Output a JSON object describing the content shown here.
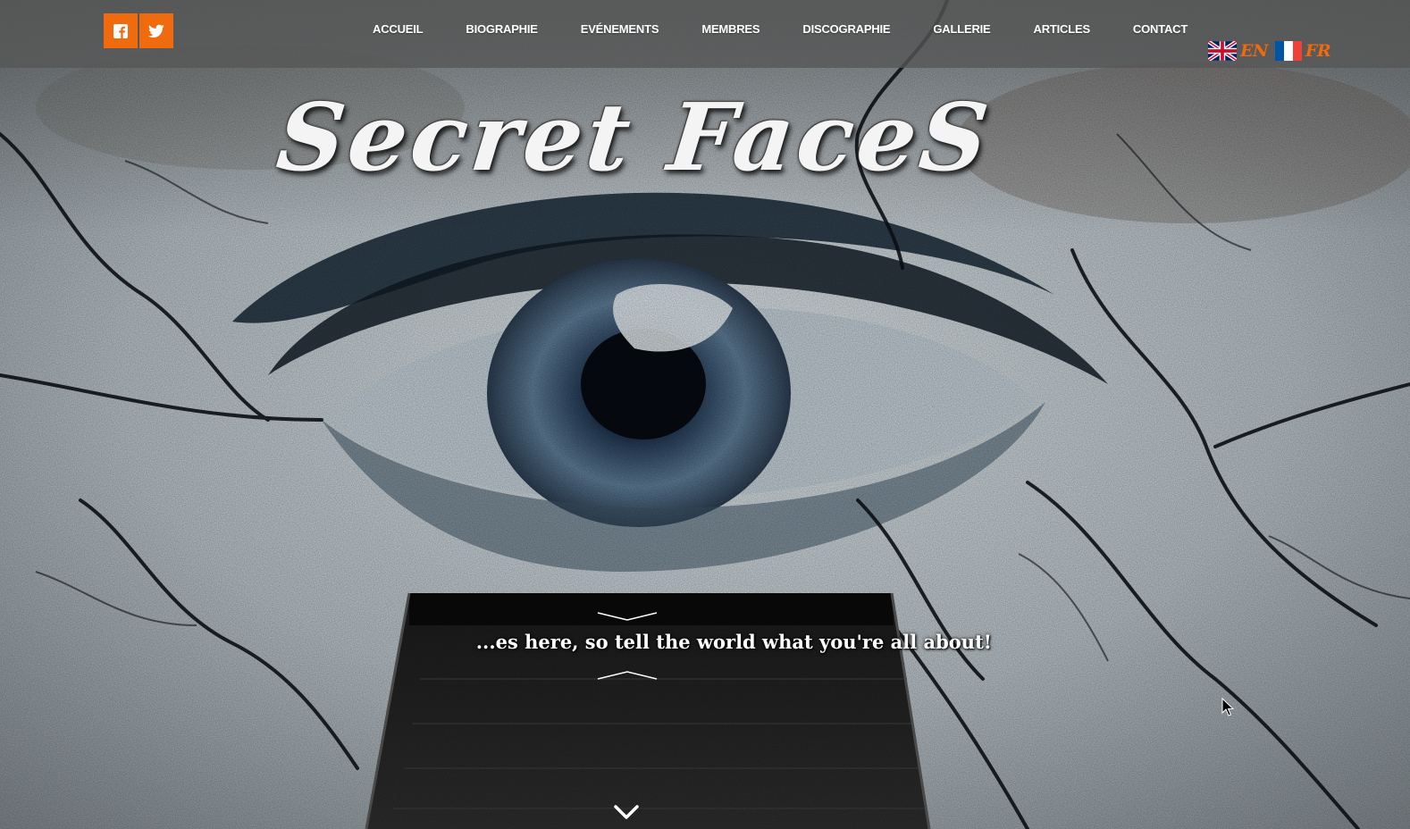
{
  "social": {
    "items": [
      {
        "icon": "facebook-icon"
      },
      {
        "icon": "twitter-icon"
      }
    ]
  },
  "nav": {
    "items": [
      {
        "label": "ACCUEIL"
      },
      {
        "label": "BIOGRAPHIE"
      },
      {
        "label": "EVÉNEMENTS"
      },
      {
        "label": "MEMBRES"
      },
      {
        "label": "DISCOGRAPHIE"
      },
      {
        "label": "GALLERIE"
      },
      {
        "label": "ARTICLES"
      },
      {
        "label": "CONTACT"
      }
    ]
  },
  "lang": {
    "en": {
      "label": "EN",
      "icon": "uk-flag-icon"
    },
    "fr": {
      "label": "FR",
      "icon": "france-flag-icon"
    }
  },
  "hero": {
    "logo_text": "Secret FaceS",
    "tagline": "...es here, so tell the world what you're all about!"
  },
  "colors": {
    "accent": "#f06a0e",
    "nav_bar": "#565656",
    "nav_text": "#ffffff"
  }
}
